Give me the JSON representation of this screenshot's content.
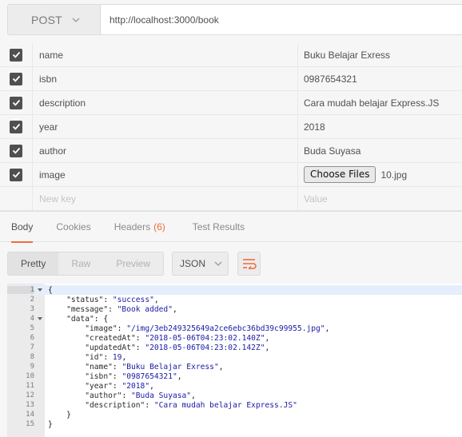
{
  "request": {
    "method": "POST",
    "url": "http://localhost:3000/book"
  },
  "params": [
    {
      "key": "name",
      "value": "Buku Belajar Exress"
    },
    {
      "key": "isbn",
      "value": "0987654321"
    },
    {
      "key": "description",
      "value": "Cara mudah belajar Express.JS"
    },
    {
      "key": "year",
      "value": "2018"
    },
    {
      "key": "author",
      "value": "Buda Suyasa"
    },
    {
      "key": "image",
      "file_button": "Choose Files",
      "file_name": "10.jpg"
    }
  ],
  "new_row": {
    "key_placeholder": "New key",
    "value_placeholder": "Value"
  },
  "tabs": {
    "body": "Body",
    "cookies": "Cookies",
    "headers": "Headers",
    "headers_count": "(6)",
    "test_results": "Test Results"
  },
  "toolbar": {
    "pretty": "Pretty",
    "raw": "Raw",
    "preview": "Preview",
    "format": "JSON"
  },
  "code_lines": [
    "1",
    "2",
    "3",
    "4",
    "5",
    "6",
    "7",
    "8",
    "9",
    "10",
    "11",
    "12",
    "13",
    "14",
    "15"
  ],
  "response": {
    "l1": "{",
    "status_key": "\"status\"",
    "status_val": "\"success\"",
    "message_key": "\"message\"",
    "message_val": "\"Book added\"",
    "data_key": "\"data\"",
    "image_key": "\"image\"",
    "image_val": "\"/img/3eb249325649a2ce6ebc36bd39c99955.jpg\"",
    "createdAt_key": "\"createdAt\"",
    "createdAt_val": "\"2018-05-06T04:23:02.140Z\"",
    "updatedAt_key": "\"updatedAt\"",
    "updatedAt_val": "\"2018-05-06T04:23:02.142Z\"",
    "id_key": "\"id\"",
    "id_val": "19",
    "name_key": "\"name\"",
    "name_val": "\"Buku Belajar Exress\"",
    "isbn_key": "\"isbn\"",
    "isbn_val": "\"0987654321\"",
    "year_key": "\"year\"",
    "year_val": "\"2018\"",
    "author_key": "\"author\"",
    "author_val": "\"Buda Suyasa\"",
    "description_key": "\"description\"",
    "description_val": "\"Cara mudah belajar Express.JS\"",
    "l14": "}",
    "l15": "}"
  },
  "colors": {
    "accent": "#f26b3a",
    "string": "#1a1aa6"
  }
}
